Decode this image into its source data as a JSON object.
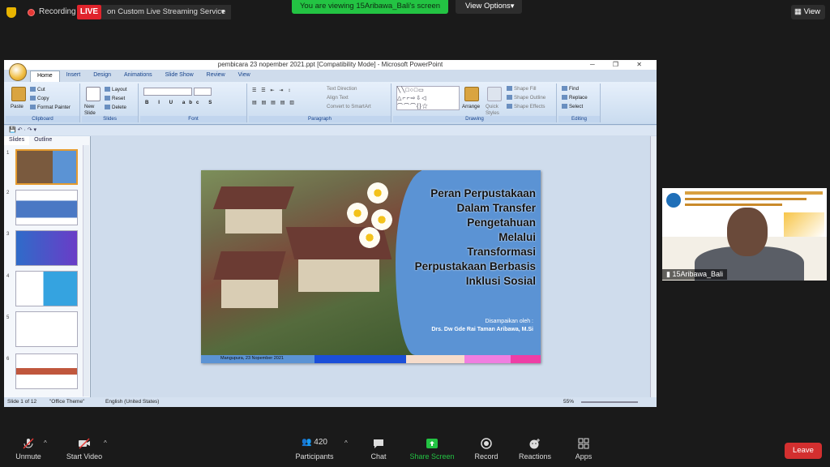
{
  "meeting": {
    "recording_label": "Recording",
    "live_label": "LIVE",
    "stream_service": "on Custom Live Streaming Service",
    "viewing_banner": "You are viewing 15Aribawa_Bali's screen",
    "view_options": "View Options",
    "view_label": "View"
  },
  "ppt": {
    "window_title": "pembicara 23 nopember 2021.ppt [Compatibility Mode] - Microsoft PowerPoint",
    "tabs": [
      "Home",
      "Insert",
      "Design",
      "Animations",
      "Slide Show",
      "Review",
      "View"
    ],
    "groups": {
      "clipboard": {
        "label": "Clipboard",
        "paste": "Paste",
        "cut": "Cut",
        "copy": "Copy",
        "format_painter": "Format Painter"
      },
      "slides": {
        "label": "Slides",
        "new_slide": "New Slide",
        "layout": "Layout",
        "reset": "Reset",
        "delete": "Delete"
      },
      "font": {
        "label": "Font"
      },
      "paragraph": {
        "label": "Paragraph",
        "text_direction": "Text Direction",
        "align_text": "Align Text",
        "convert": "Convert to SmartArt"
      },
      "drawing": {
        "label": "Drawing",
        "arrange": "Arrange",
        "quick_styles": "Quick Styles",
        "shape_fill": "Shape Fill",
        "shape_outline": "Shape Outline",
        "shape_effects": "Shape Effects"
      },
      "editing": {
        "label": "Editing",
        "find": "Find",
        "replace": "Replace",
        "select": "Select"
      }
    },
    "pane_tabs": [
      "Slides",
      "Outline"
    ],
    "thumb_numbers": [
      "1",
      "2",
      "3",
      "4",
      "5",
      "6"
    ],
    "status": {
      "slide_of": "Slide 1 of 12",
      "theme": "\"Office Theme\"",
      "language": "English (United States)",
      "zoom": "55%"
    },
    "slide": {
      "title_lines": [
        "Peran Perpustakaan",
        "Dalam Transfer",
        "Pengetahuan",
        "Melalui",
        "Transformasi",
        "Perpustakaan Berbasis",
        "Inklusi Sosial"
      ],
      "presented_by": "Disampaikan oleh :",
      "presenter": "Drs. Dw Gde Rai Taman Aribawa, M.Si",
      "footer": "Mangupura, 23 Nopember 2021",
      "band_colors": [
        "#5b93d4",
        "#1b4fd8",
        "#f6dccb",
        "#f07ee0",
        "#ee3ea6"
      ]
    }
  },
  "video": {
    "participant_name": "15Aribawa_Bali"
  },
  "toolbar": {
    "unmute": "Unmute",
    "start_video": "Start Video",
    "participants": "Participants",
    "participants_count": "420",
    "chat": "Chat",
    "share_screen": "Share Screen",
    "record": "Record",
    "reactions": "Reactions",
    "apps": "Apps",
    "leave": "Leave"
  }
}
